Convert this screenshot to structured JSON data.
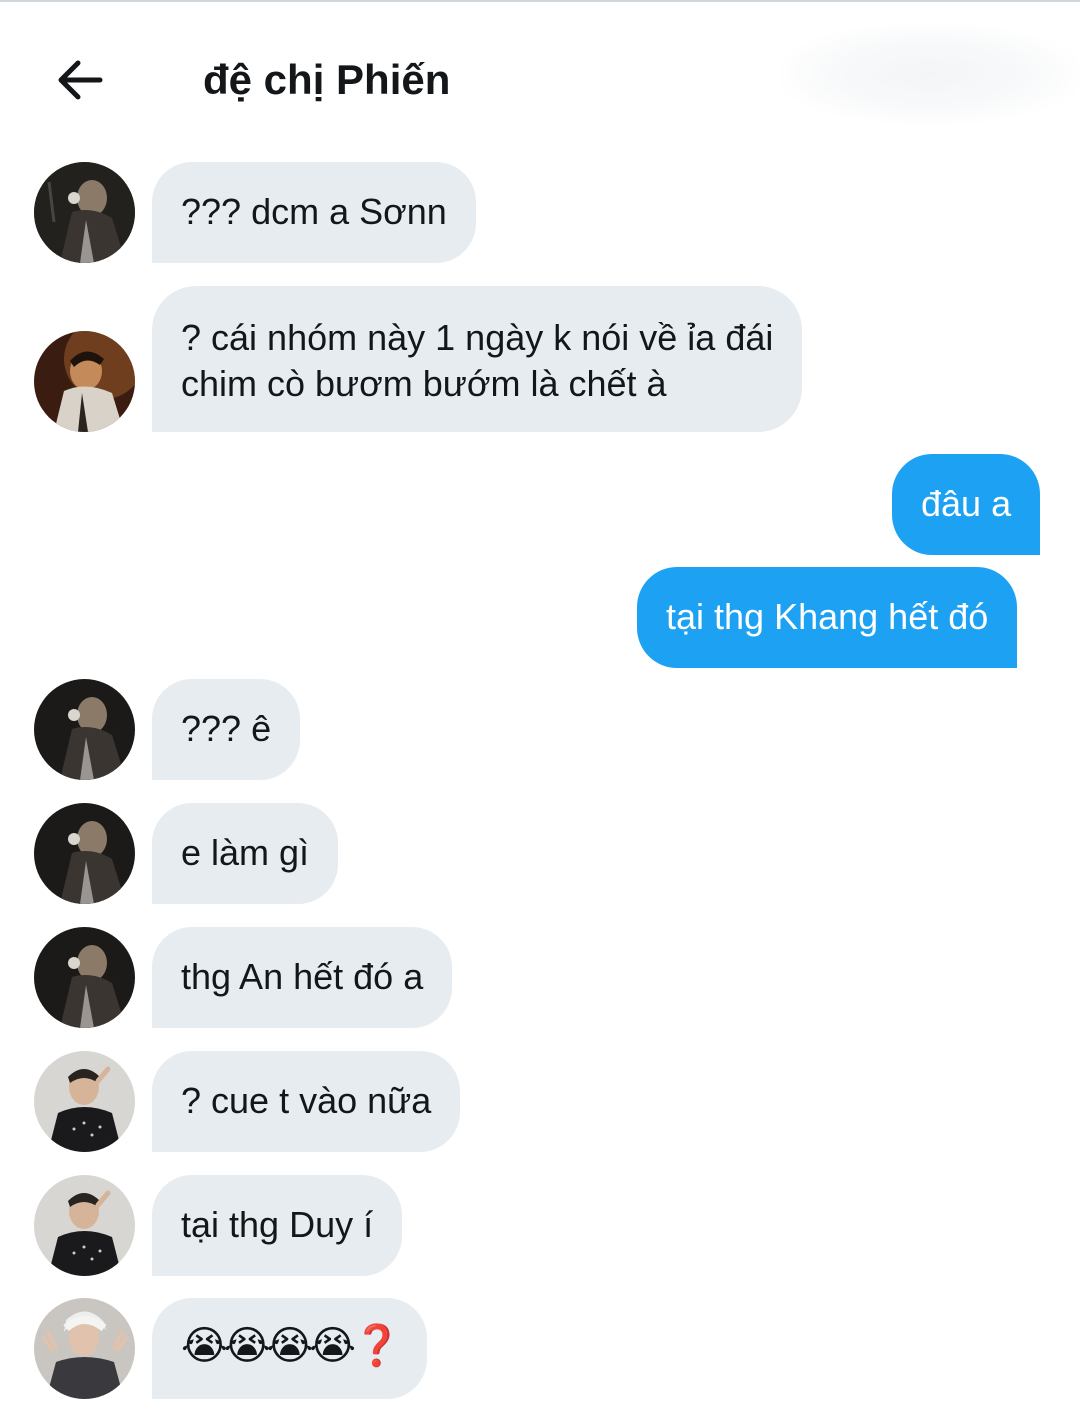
{
  "header": {
    "title": "đệ chị Phiến",
    "back_icon": "arrow-left-icon"
  },
  "messages": [
    {
      "side": "in",
      "avatar": "avatar-dark-jacket",
      "text": "??? dcm a Sơnn"
    },
    {
      "side": "in",
      "avatar": "avatar-warm-portrait",
      "lines": [
        "? cái nhóm này 1 ngày k nói về ỉa đái",
        "chim cò bươm bướm là chết à"
      ]
    },
    {
      "side": "out",
      "text": "đâu a"
    },
    {
      "side": "out",
      "text": "tại thg Khang hết đó"
    },
    {
      "side": "in",
      "avatar": "avatar-dark-jacket",
      "text": "??? ê"
    },
    {
      "side": "in",
      "avatar": "avatar-dark-jacket",
      "text": "e làm gì"
    },
    {
      "side": "in",
      "avatar": "avatar-dark-jacket",
      "text": "thg An hết đó a"
    },
    {
      "side": "in",
      "avatar": "avatar-sparkle-jacket",
      "text": "? cue t vào nữa"
    },
    {
      "side": "in",
      "avatar": "avatar-sparkle-jacket",
      "text": "tại thg Duy í"
    },
    {
      "side": "in",
      "avatar": "avatar-white-hair",
      "emoji": "😭😭😭😭❓"
    }
  ],
  "colors": {
    "incoming_bubble": "#e6ecf0",
    "outgoing_bubble": "#1da1f2",
    "text": "#14171a"
  }
}
